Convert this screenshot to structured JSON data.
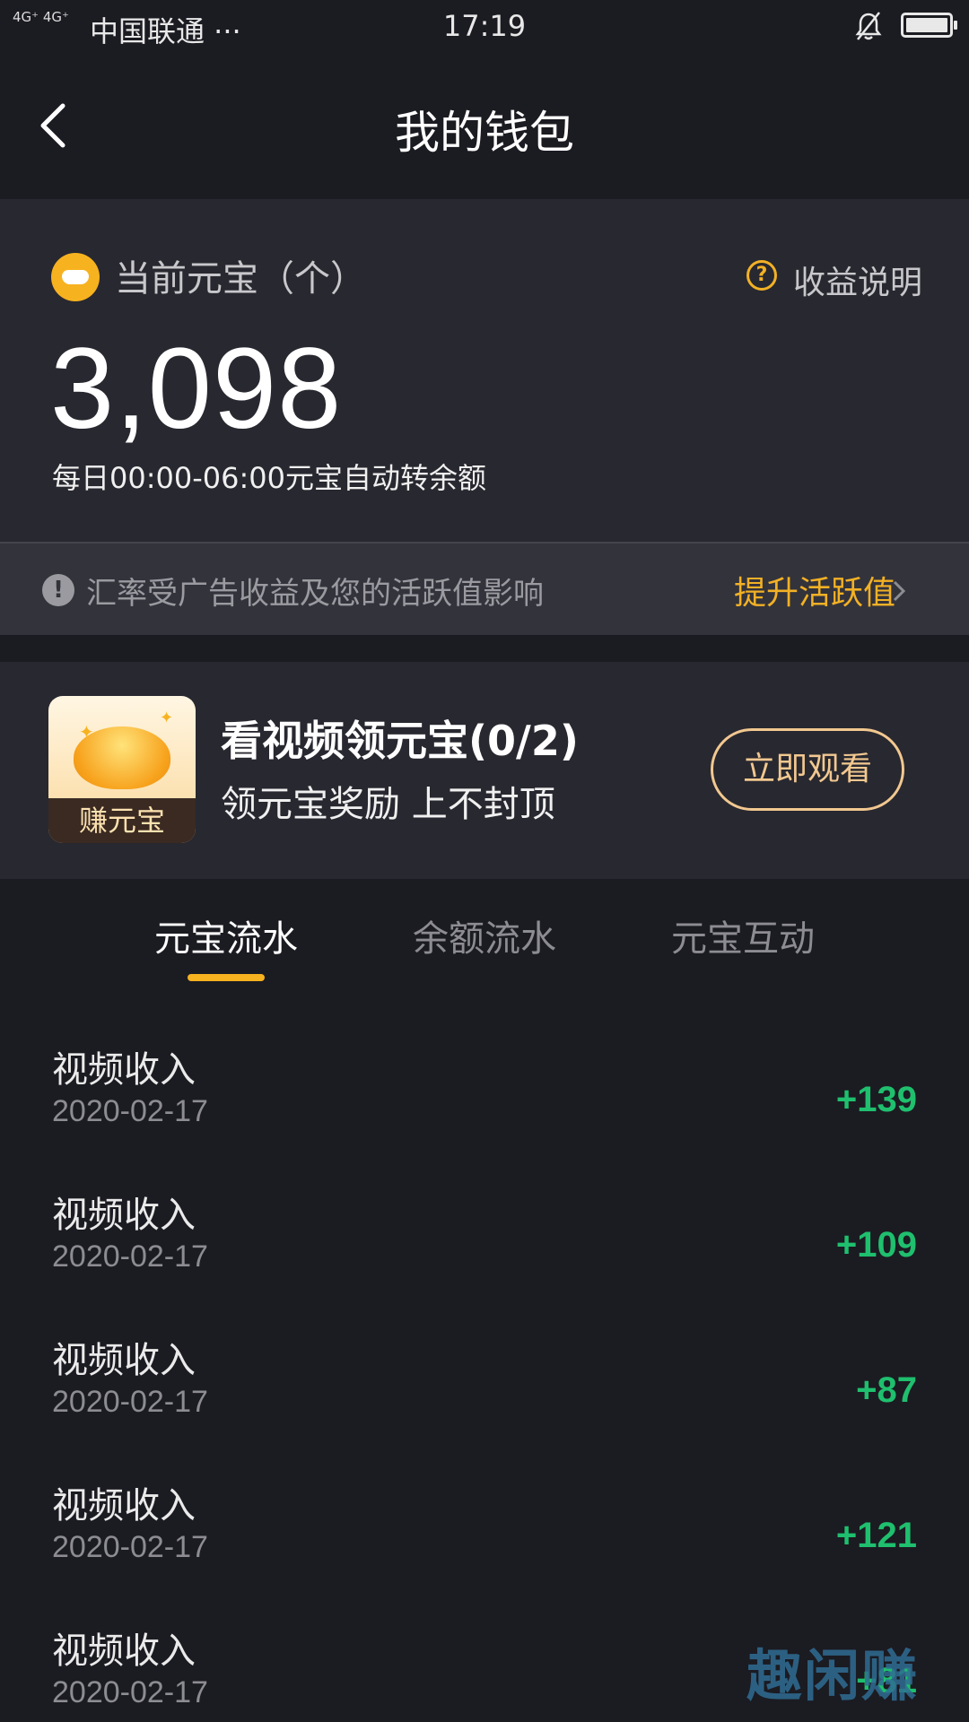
{
  "status_bar": {
    "network": "4G⁺ 4G⁺",
    "carrier": "中国联通 ···",
    "time": "17:19"
  },
  "nav": {
    "title": "我的钱包"
  },
  "balance": {
    "label": "当前元宝（个）",
    "help_text": "收益说明",
    "help_icon": "?",
    "amount": "3,098",
    "note": "每日00:00-06:00元宝自动转余额"
  },
  "notice": {
    "icon": "!",
    "text": "汇率受广告收益及您的活跃值影响",
    "link": "提升活跃值"
  },
  "promo": {
    "thumb_label": "赚元宝",
    "title": "看视频领元宝(0/2)",
    "subtitle": "领元宝奖励 上不封顶",
    "button": "立即观看"
  },
  "tabs": [
    {
      "label": "元宝流水",
      "active": true
    },
    {
      "label": "余额流水",
      "active": false
    },
    {
      "label": "元宝互动",
      "active": false
    }
  ],
  "records": [
    {
      "name": "视频收入",
      "date": "2020-02-17",
      "delta": "+139"
    },
    {
      "name": "视频收入",
      "date": "2020-02-17",
      "delta": "+109"
    },
    {
      "name": "视频收入",
      "date": "2020-02-17",
      "delta": "+87"
    },
    {
      "name": "视频收入",
      "date": "2020-02-17",
      "delta": "+121"
    },
    {
      "name": "视频收入",
      "date": "2020-02-17",
      "delta": "+81"
    }
  ],
  "watermark": "趣闲赚",
  "colors": {
    "accent": "#f2b125",
    "income": "#1fbf6e",
    "background": "#1b1b22",
    "card": "#282830"
  }
}
